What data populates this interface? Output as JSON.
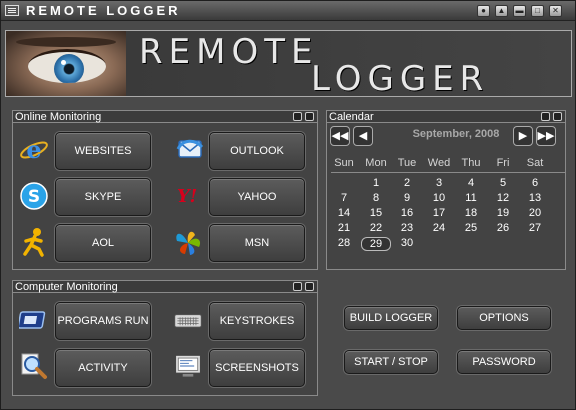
{
  "window": {
    "title": "REMOTE LOGGER",
    "controls": [
      "help",
      "minimize-to-tray",
      "minimize",
      "maximize",
      "close"
    ]
  },
  "banner": {
    "line1": "REMOTE",
    "line2": "LOGGER"
  },
  "online": {
    "title": "Online Monitoring",
    "buttons": [
      {
        "label": "WEBSITES",
        "icon": "internet-explorer-icon"
      },
      {
        "label": "OUTLOOK",
        "icon": "outlook-icon"
      },
      {
        "label": "SKYPE",
        "icon": "skype-icon"
      },
      {
        "label": "YAHOO",
        "icon": "yahoo-messenger-icon"
      },
      {
        "label": "AOL",
        "icon": "aol-running-man-icon"
      },
      {
        "label": "MSN",
        "icon": "msn-butterfly-icon"
      }
    ]
  },
  "computer": {
    "title": "Computer Monitoring",
    "buttons": [
      {
        "label": "PROGRAMS RUN",
        "icon": "program-window-icon"
      },
      {
        "label": "KEYSTROKES",
        "icon": "keyboard-icon"
      },
      {
        "label": "ACTIVITY",
        "icon": "magnifier-icon"
      },
      {
        "label": "SCREENSHOTS",
        "icon": "screenshot-monitor-icon"
      }
    ]
  },
  "calendar": {
    "title": "Calendar",
    "month": "September, 2008",
    "weekdays": [
      "Sun",
      "Mon",
      "Tue",
      "Wed",
      "Thu",
      "Fri",
      "Sat"
    ],
    "weeks": [
      [
        "",
        "1",
        "2",
        "3",
        "4",
        "5",
        "6"
      ],
      [
        "7",
        "8",
        "9",
        "10",
        "11",
        "12",
        "13"
      ],
      [
        "14",
        "15",
        "16",
        "17",
        "18",
        "19",
        "20"
      ],
      [
        "21",
        "22",
        "23",
        "24",
        "25",
        "26",
        "27"
      ],
      [
        "28",
        "29",
        "30",
        "",
        "",
        "",
        ""
      ]
    ],
    "selected": "29",
    "nav": {
      "first": "◀◀",
      "prev": "◀",
      "next": "▶",
      "last": "▶▶"
    }
  },
  "actions": {
    "build": "BUILD LOGGER",
    "options": "OPTIONS",
    "startstop": "START / STOP",
    "password": "PASSWORD"
  }
}
